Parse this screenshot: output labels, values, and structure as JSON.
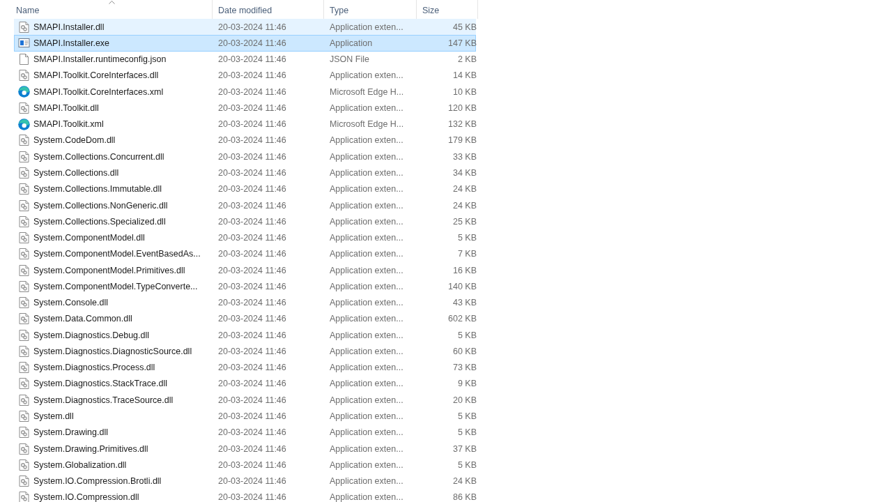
{
  "columns": [
    {
      "label": "Name",
      "sorted": true
    },
    {
      "label": "Date modified",
      "sorted": false
    },
    {
      "label": "Type",
      "sorted": false
    },
    {
      "label": "Size",
      "sorted": false
    }
  ],
  "rows": [
    {
      "kind": "dll",
      "name": "SMAPI.Installer.dll",
      "date": "20-03-2024 11:46",
      "type": "Application exten...",
      "size": "45 KB",
      "hovered": true,
      "selected": false
    },
    {
      "kind": "exe",
      "name": "SMAPI.Installer.exe",
      "date": "20-03-2024 11:46",
      "type": "Application",
      "size": "147 KB",
      "hovered": false,
      "selected": true
    },
    {
      "kind": "file",
      "name": "SMAPI.Installer.runtimeconfig.json",
      "date": "20-03-2024 11:46",
      "type": "JSON File",
      "size": "2 KB",
      "hovered": false,
      "selected": false
    },
    {
      "kind": "dll",
      "name": "SMAPI.Toolkit.CoreInterfaces.dll",
      "date": "20-03-2024 11:46",
      "type": "Application exten...",
      "size": "14 KB",
      "hovered": false,
      "selected": false
    },
    {
      "kind": "edge",
      "name": "SMAPI.Toolkit.CoreInterfaces.xml",
      "date": "20-03-2024 11:46",
      "type": "Microsoft Edge H...",
      "size": "10 KB",
      "hovered": false,
      "selected": false
    },
    {
      "kind": "dll",
      "name": "SMAPI.Toolkit.dll",
      "date": "20-03-2024 11:46",
      "type": "Application exten...",
      "size": "120 KB",
      "hovered": false,
      "selected": false
    },
    {
      "kind": "edge",
      "name": "SMAPI.Toolkit.xml",
      "date": "20-03-2024 11:46",
      "type": "Microsoft Edge H...",
      "size": "132 KB",
      "hovered": false,
      "selected": false
    },
    {
      "kind": "dll",
      "name": "System.CodeDom.dll",
      "date": "20-03-2024 11:46",
      "type": "Application exten...",
      "size": "179 KB",
      "hovered": false,
      "selected": false
    },
    {
      "kind": "dll",
      "name": "System.Collections.Concurrent.dll",
      "date": "20-03-2024 11:46",
      "type": "Application exten...",
      "size": "33 KB",
      "hovered": false,
      "selected": false
    },
    {
      "kind": "dll",
      "name": "System.Collections.dll",
      "date": "20-03-2024 11:46",
      "type": "Application exten...",
      "size": "34 KB",
      "hovered": false,
      "selected": false
    },
    {
      "kind": "dll",
      "name": "System.Collections.Immutable.dll",
      "date": "20-03-2024 11:46",
      "type": "Application exten...",
      "size": "24 KB",
      "hovered": false,
      "selected": false
    },
    {
      "kind": "dll",
      "name": "System.Collections.NonGeneric.dll",
      "date": "20-03-2024 11:46",
      "type": "Application exten...",
      "size": "24 KB",
      "hovered": false,
      "selected": false
    },
    {
      "kind": "dll",
      "name": "System.Collections.Specialized.dll",
      "date": "20-03-2024 11:46",
      "type": "Application exten...",
      "size": "25 KB",
      "hovered": false,
      "selected": false
    },
    {
      "kind": "dll",
      "name": "System.ComponentModel.dll",
      "date": "20-03-2024 11:46",
      "type": "Application exten...",
      "size": "5 KB",
      "hovered": false,
      "selected": false
    },
    {
      "kind": "dll",
      "name": "System.ComponentModel.EventBasedAs...",
      "date": "20-03-2024 11:46",
      "type": "Application exten...",
      "size": "7 KB",
      "hovered": false,
      "selected": false
    },
    {
      "kind": "dll",
      "name": "System.ComponentModel.Primitives.dll",
      "date": "20-03-2024 11:46",
      "type": "Application exten...",
      "size": "16 KB",
      "hovered": false,
      "selected": false
    },
    {
      "kind": "dll",
      "name": "System.ComponentModel.TypeConverte...",
      "date": "20-03-2024 11:46",
      "type": "Application exten...",
      "size": "140 KB",
      "hovered": false,
      "selected": false
    },
    {
      "kind": "dll",
      "name": "System.Console.dll",
      "date": "20-03-2024 11:46",
      "type": "Application exten...",
      "size": "43 KB",
      "hovered": false,
      "selected": false
    },
    {
      "kind": "dll",
      "name": "System.Data.Common.dll",
      "date": "20-03-2024 11:46",
      "type": "Application exten...",
      "size": "602 KB",
      "hovered": false,
      "selected": false
    },
    {
      "kind": "dll",
      "name": "System.Diagnostics.Debug.dll",
      "date": "20-03-2024 11:46",
      "type": "Application exten...",
      "size": "5 KB",
      "hovered": false,
      "selected": false
    },
    {
      "kind": "dll",
      "name": "System.Diagnostics.DiagnosticSource.dll",
      "date": "20-03-2024 11:46",
      "type": "Application exten...",
      "size": "60 KB",
      "hovered": false,
      "selected": false
    },
    {
      "kind": "dll",
      "name": "System.Diagnostics.Process.dll",
      "date": "20-03-2024 11:46",
      "type": "Application exten...",
      "size": "73 KB",
      "hovered": false,
      "selected": false
    },
    {
      "kind": "dll",
      "name": "System.Diagnostics.StackTrace.dll",
      "date": "20-03-2024 11:46",
      "type": "Application exten...",
      "size": "9 KB",
      "hovered": false,
      "selected": false
    },
    {
      "kind": "dll",
      "name": "System.Diagnostics.TraceSource.dll",
      "date": "20-03-2024 11:46",
      "type": "Application exten...",
      "size": "20 KB",
      "hovered": false,
      "selected": false
    },
    {
      "kind": "dll",
      "name": "System.dll",
      "date": "20-03-2024 11:46",
      "type": "Application exten...",
      "size": "5 KB",
      "hovered": false,
      "selected": false
    },
    {
      "kind": "dll",
      "name": "System.Drawing.dll",
      "date": "20-03-2024 11:46",
      "type": "Application exten...",
      "size": "5 KB",
      "hovered": false,
      "selected": false
    },
    {
      "kind": "dll",
      "name": "System.Drawing.Primitives.dll",
      "date": "20-03-2024 11:46",
      "type": "Application exten...",
      "size": "37 KB",
      "hovered": false,
      "selected": false
    },
    {
      "kind": "dll",
      "name": "System.Globalization.dll",
      "date": "20-03-2024 11:46",
      "type": "Application exten...",
      "size": "5 KB",
      "hovered": false,
      "selected": false
    },
    {
      "kind": "dll",
      "name": "System.IO.Compression.Brotli.dll",
      "date": "20-03-2024 11:46",
      "type": "Application exten...",
      "size": "24 KB",
      "hovered": false,
      "selected": false
    },
    {
      "kind": "dll",
      "name": "System.IO.Compression.dll",
      "date": "20-03-2024 11:46",
      "type": "Application exten...",
      "size": "86 KB",
      "hovered": false,
      "selected": false
    }
  ]
}
